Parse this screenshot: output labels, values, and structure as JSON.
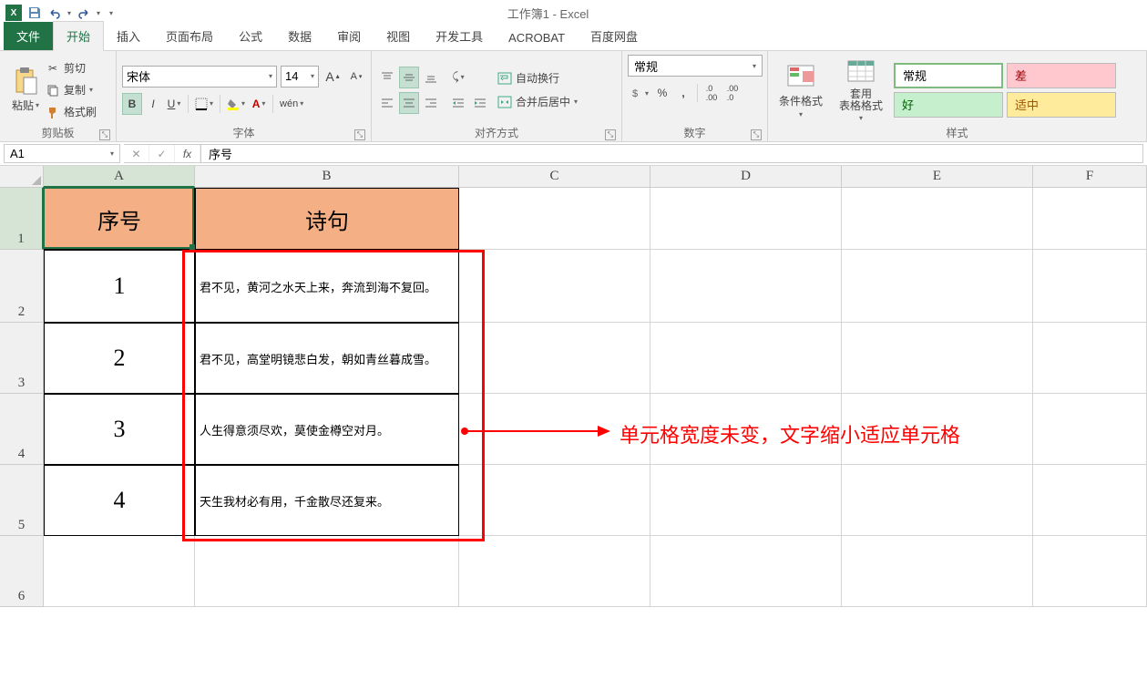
{
  "app": {
    "title": "工作簿1 - Excel"
  },
  "tabs": {
    "file": "文件",
    "home": "开始",
    "insert": "插入",
    "layout": "页面布局",
    "formula": "公式",
    "data": "数据",
    "review": "审阅",
    "view": "视图",
    "dev": "开发工具",
    "acrobat": "ACROBAT",
    "baidu": "百度网盘"
  },
  "clipboard": {
    "paste": "粘贴",
    "cut": "剪切",
    "copy": "复制",
    "format_painter": "格式刷",
    "label": "剪贴板"
  },
  "font": {
    "name": "宋体",
    "size": "14",
    "label": "字体"
  },
  "alignment": {
    "wrap": "自动换行",
    "merge": "合并后居中",
    "label": "对齐方式"
  },
  "number": {
    "format": "常规",
    "label": "数字"
  },
  "styles": {
    "cond": "条件格式",
    "table": "套用\n表格格式",
    "normal": "常规",
    "bad": "差",
    "good": "好",
    "neutral": "适中",
    "label": "样式"
  },
  "formula_bar": {
    "cell_ref": "A1",
    "content": "序号",
    "fx": "fx"
  },
  "columns": [
    "A",
    "B",
    "C",
    "D",
    "E",
    "F"
  ],
  "rows": [
    "1",
    "2",
    "3",
    "4",
    "5",
    "6"
  ],
  "sheet": {
    "h1": "序号",
    "h2": "诗句",
    "r1n": "1",
    "r1t": "君不见，黄河之水天上来，奔流到海不复回。",
    "r2n": "2",
    "r2t": "君不见，高堂明镜悲白发，朝如青丝暮成雪。",
    "r3n": "3",
    "r3t": "人生得意须尽欢，莫使金樽空对月。",
    "r4n": "4",
    "r4t": "天生我材必有用，千金散尽还复来。"
  },
  "annotation": "单元格宽度未变，文字缩小适应单元格"
}
